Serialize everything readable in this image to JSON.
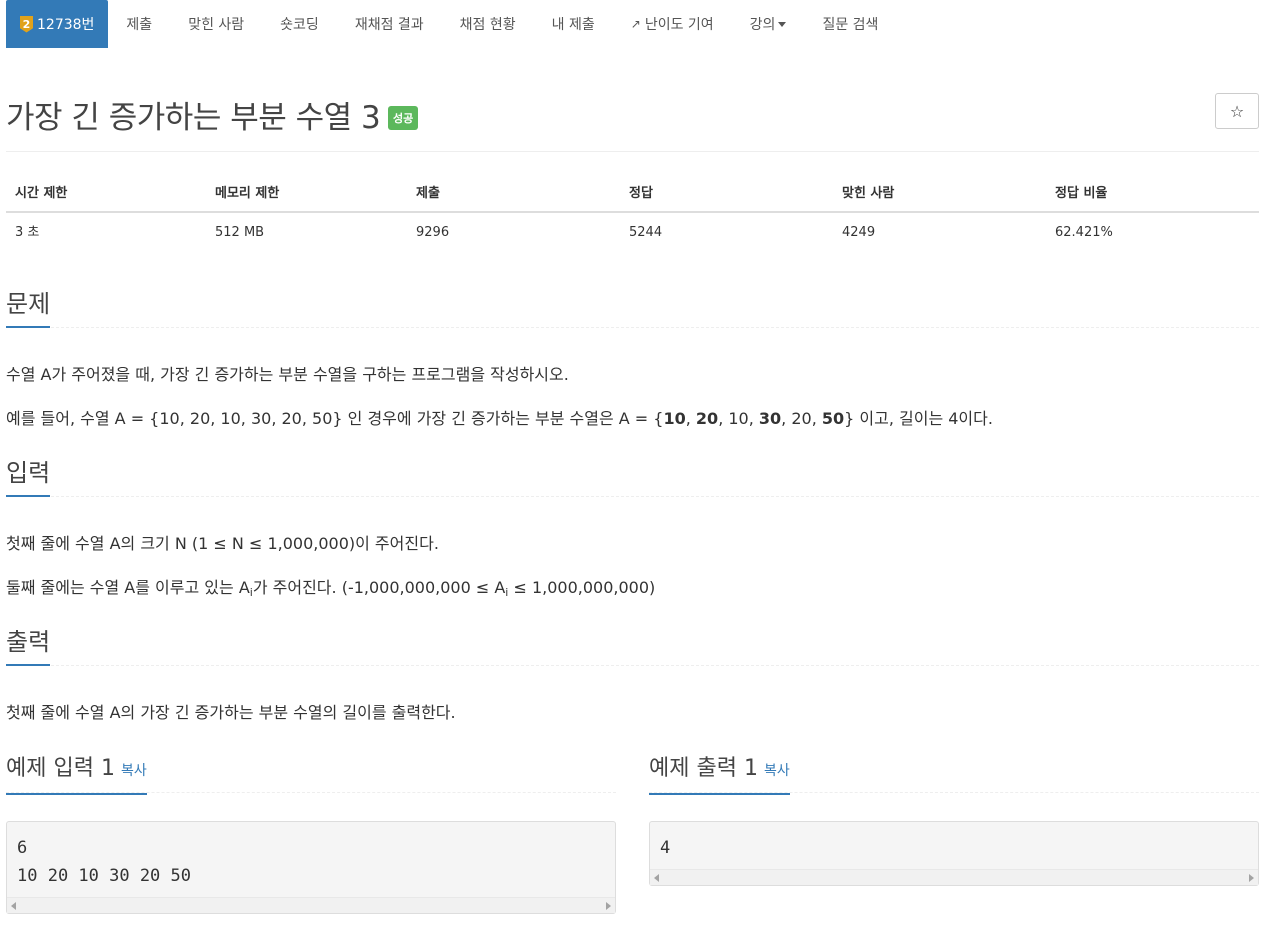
{
  "nav": {
    "problem": {
      "tier": "2",
      "label": "12738번"
    },
    "items": [
      "제출",
      "맞힌 사람",
      "숏코딩",
      "재채점 결과",
      "채점 현황",
      "내 제출",
      "난이도 기여",
      "강의",
      "질문 검색"
    ]
  },
  "title": "가장 긴 증가하는 부분 수열 3",
  "badge": "성공",
  "star_glyph": "☆",
  "info": {
    "headers": [
      "시간 제한",
      "메모리 제한",
      "제출",
      "정답",
      "맞힌 사람",
      "정답 비율"
    ],
    "values": [
      "3 초",
      "512 MB",
      "9296",
      "5244",
      "4249",
      "62.421%"
    ]
  },
  "sections": {
    "problem": {
      "heading": "문제",
      "p1": "수열 A가 주어졌을 때, 가장 긴 증가하는 부분 수열을 구하는 프로그램을 작성하시오.",
      "p2_pre": "예를 들어, 수열 A = {10, 20, 10, 30, 20, 50} 인 경우에 가장 긴 증가하는 부분 수열은 A = {",
      "p2_b1": "10",
      "p2_s1": ", ",
      "p2_b2": "20",
      "p2_s2": ", 10, ",
      "p2_b3": "30",
      "p2_s3": ", 20, ",
      "p2_b4": "50",
      "p2_post": "} 이고, 길이는 4이다."
    },
    "input": {
      "heading": "입력",
      "p1": "첫째 줄에 수열 A의 크기 N (1 ≤ N ≤ 1,000,000)이 주어진다.",
      "p2_a": "둘째 줄에는 수열 A를 이루고 있는 A",
      "p2_sub": "i",
      "p2_b": "가 주어진다. (-1,000,000,000 ≤ A",
      "p2_sub2": "i",
      "p2_c": " ≤ 1,000,000,000)"
    },
    "output": {
      "heading": "출력",
      "p1": "첫째 줄에 수열 A의 가장 긴 증가하는 부분 수열의 길이를 출력한다."
    }
  },
  "examples": {
    "input": {
      "heading": "예제 입력 1",
      "copy": "복사",
      "text": "6\n10 20 10 30 20 50"
    },
    "output": {
      "heading": "예제 출력 1",
      "copy": "복사",
      "text": "4"
    }
  },
  "colors": {
    "accent": "#337ab7",
    "success": "#5cb85c",
    "tier": "#e0a21b"
  }
}
